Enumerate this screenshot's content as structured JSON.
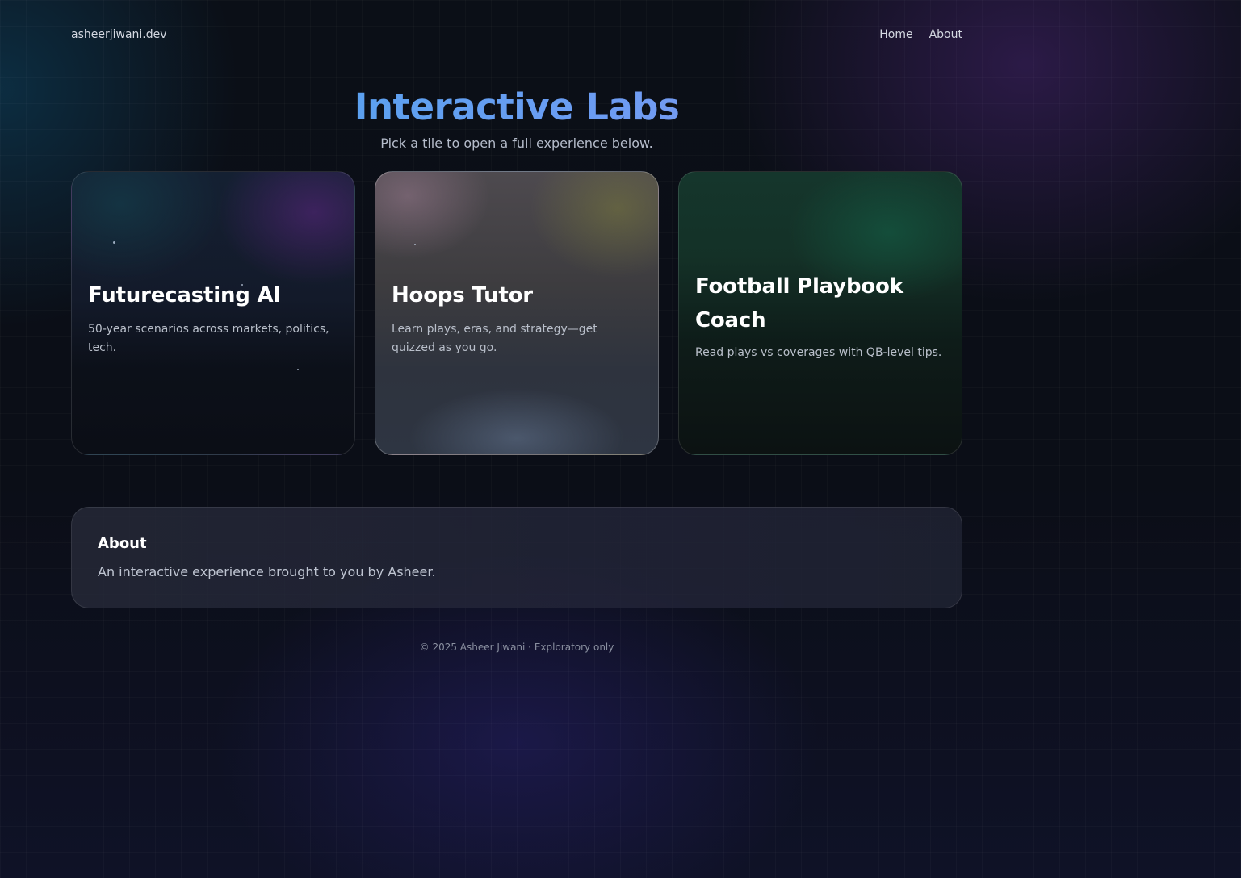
{
  "nav": {
    "brand": "asheerjiwani.dev",
    "links": [
      {
        "label": "Home"
      },
      {
        "label": "About"
      }
    ]
  },
  "hero": {
    "title": "Interactive Labs",
    "subtitle": "Pick a tile to open a full experience below."
  },
  "tiles": [
    {
      "title": "Futurecasting AI",
      "description": "50-year scenarios across markets, politics, tech."
    },
    {
      "title": "Hoops Tutor",
      "description": "Learn plays, eras, and strategy—get quizzed as you go."
    },
    {
      "title": "Football Playbook Coach",
      "description": "Read plays vs coverages with QB-level tips."
    }
  ],
  "about": {
    "heading": "About",
    "text": "An interactive experience brought to you by Asheer."
  },
  "footer": {
    "text": "© 2025 Asheer Jiwani · Exploratory only"
  },
  "colors": {
    "background": "#0b0f17",
    "title_gradient_start": "#4aa6ee",
    "title_gradient_end": "#8d95ee",
    "text_primary": "#ffffff",
    "text_muted": "#b9bfca"
  }
}
